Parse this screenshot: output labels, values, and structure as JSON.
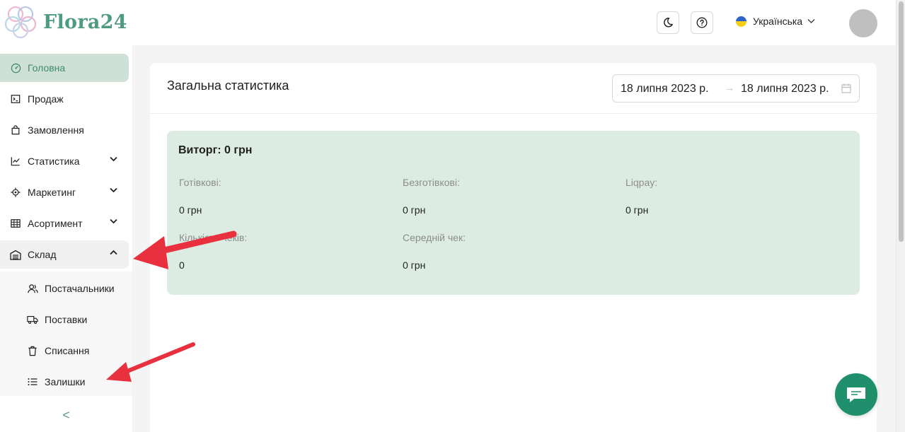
{
  "app": {
    "name": "Flora24"
  },
  "header": {
    "language": "Українська",
    "icons": {
      "theme": "moon-icon",
      "help": "question-icon",
      "chevron": "chevron-down-icon"
    }
  },
  "sidebar": {
    "items": [
      {
        "label": "Головна",
        "icon": "dashboard-icon",
        "active": true
      },
      {
        "label": "Продаж",
        "icon": "terminal-icon"
      },
      {
        "label": "Замовлення",
        "icon": "bag-icon"
      },
      {
        "label": "Статистика",
        "icon": "line-chart-icon",
        "expandable": true
      },
      {
        "label": "Маркетинг",
        "icon": "target-icon",
        "expandable": true
      },
      {
        "label": "Асортимент",
        "icon": "table-icon",
        "expandable": true
      },
      {
        "label": "Склад",
        "icon": "warehouse-icon",
        "expandable": true,
        "expanded": true
      }
    ],
    "subitems": [
      {
        "label": "Постачальники",
        "icon": "users-icon"
      },
      {
        "label": "Поставки",
        "icon": "truck-icon"
      },
      {
        "label": "Списання",
        "icon": "trash-icon"
      },
      {
        "label": "Залишки",
        "icon": "list-icon"
      }
    ],
    "collapse_glyph": "<"
  },
  "main": {
    "title": "Загальна статистика",
    "date_from": "18 липня 2023 р.",
    "date_separator": "→",
    "date_to": "18 липня 2023 р.",
    "stats": {
      "revenue": "Виторг: 0 грн",
      "cells": [
        {
          "label": "Готівкові",
          "value": "0 грн"
        },
        {
          "label": "Безготівкові",
          "value": "0 грн"
        },
        {
          "label": "Liqpay",
          "value": "0 грн"
        },
        {
          "label": "Кількість чеків",
          "value": "0"
        },
        {
          "label": "Середній чек",
          "value": "0 грн"
        }
      ]
    }
  },
  "colors": {
    "brand": "#4f9b7f",
    "active_bg": "#cfe1d6",
    "stats_bg": "#ddece3",
    "chat": "#1f8f6c",
    "annotation": "#e8303f"
  }
}
